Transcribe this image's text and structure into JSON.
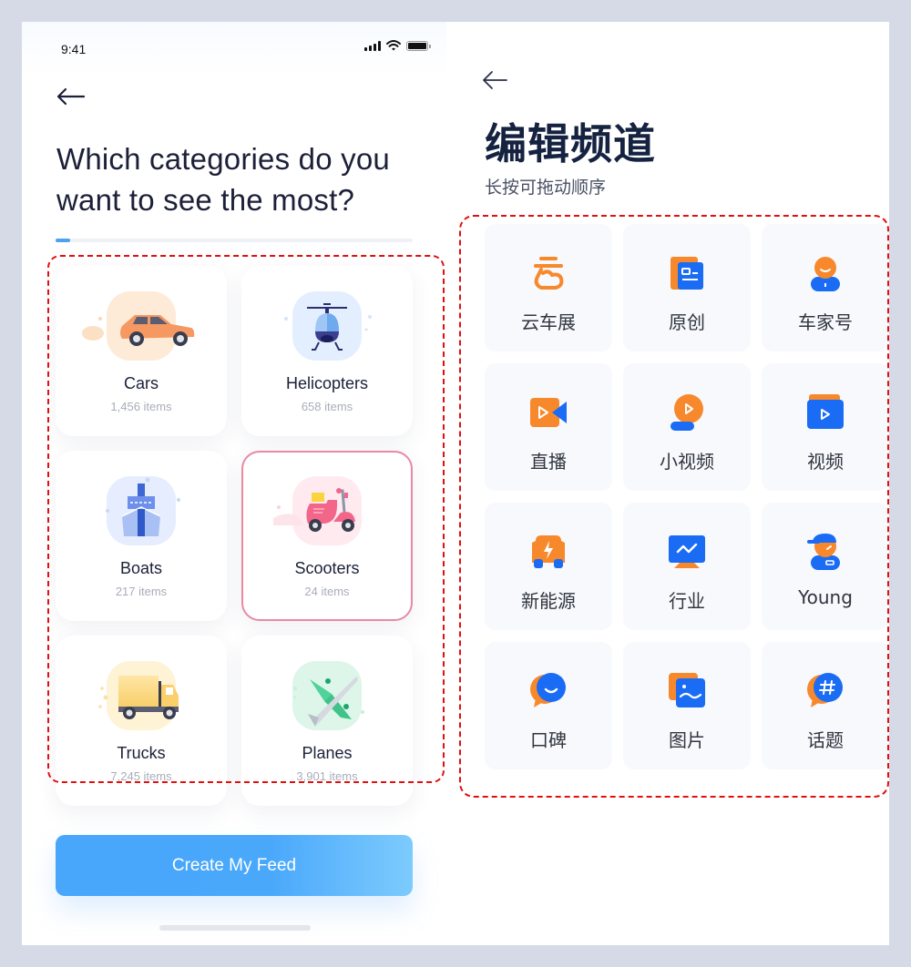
{
  "left_screen": {
    "status_bar": {
      "time": "9:41",
      "icons": [
        "signal-icon",
        "wifi-icon",
        "battery-icon"
      ]
    },
    "back_icon": "arrow-left-icon",
    "headline": "Which categories do you want to see the most?",
    "progress": {
      "value_percent": 4,
      "color": "#4aa3f0"
    },
    "categories": [
      {
        "name": "Cars",
        "count": "1,456 items",
        "icon": "car-icon",
        "tint": "#fdebd8",
        "selected": false
      },
      {
        "name": "Helicopters",
        "count": "658 items",
        "icon": "helicopter-icon",
        "tint": "#e3efff",
        "selected": false
      },
      {
        "name": "Boats",
        "count": "217 items",
        "icon": "boat-icon",
        "tint": "#e6edff",
        "selected": false
      },
      {
        "name": "Scooters",
        "count": "24 items",
        "icon": "scooter-icon",
        "tint": "#ffeaf0",
        "selected": true
      },
      {
        "name": "Trucks",
        "count": "7,245 items",
        "icon": "truck-icon",
        "tint": "#fff3d6",
        "selected": false
      },
      {
        "name": "Planes",
        "count": "3,901 items",
        "icon": "plane-icon",
        "tint": "#ddf6e9",
        "selected": false
      }
    ],
    "cta_label": "Create My Feed",
    "selected_border_color": "#e88aa3",
    "highlight_color": "#e01010"
  },
  "right_screen": {
    "back_icon": "arrow-left-icon",
    "title": "编辑频道",
    "subtitle": "长按可拖动顺序",
    "channels": [
      {
        "label": "云车展",
        "icon": "cloud-expo-icon"
      },
      {
        "label": "原创",
        "icon": "original-card-icon"
      },
      {
        "label": "车家号",
        "icon": "user-account-icon"
      },
      {
        "label": "直播",
        "icon": "live-camera-icon"
      },
      {
        "label": "小视频",
        "icon": "short-video-icon"
      },
      {
        "label": "视频",
        "icon": "video-icon"
      },
      {
        "label": "新能源",
        "icon": "electric-car-icon"
      },
      {
        "label": "行业",
        "icon": "industry-monitor-icon"
      },
      {
        "label": "Young",
        "icon": "young-user-icon"
      },
      {
        "label": "口碑",
        "icon": "review-chat-icon"
      },
      {
        "label": "图片",
        "icon": "picture-icon"
      },
      {
        "label": "话题",
        "icon": "topic-hashtag-icon"
      }
    ],
    "colors": {
      "orange": "#f7892c",
      "blue": "#1a6cf5",
      "card_bg": "#f7f9fc"
    }
  }
}
